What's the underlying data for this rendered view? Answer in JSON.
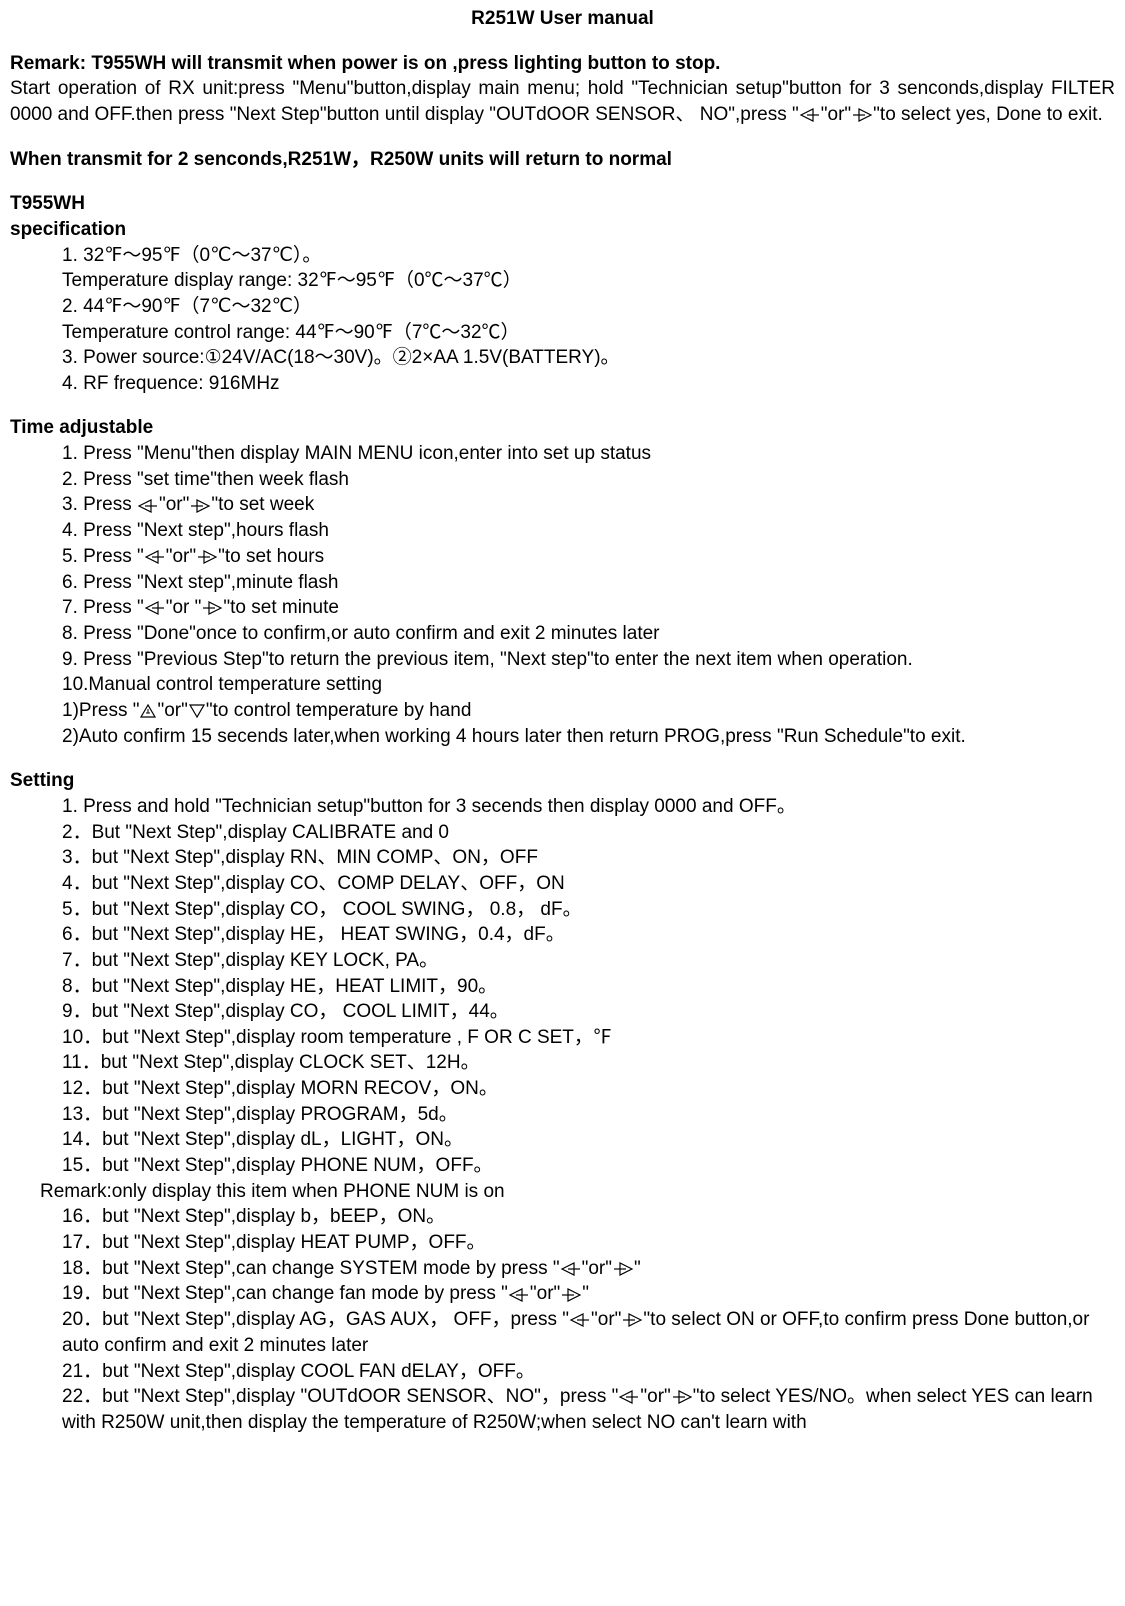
{
  "title": "R251W User manual",
  "remark": {
    "heading": "Remark: T955WH will transmit when power is on ,press lighting button to stop.",
    "line1a": "Start  operation  of  RX  unit:press  \"Menu\"button,display  main  menu;  hold  \"Technician  setup\"button  for  3 senconds,display  FILTER    0000   and  OFF.then  press  \"Next  Step\"button  until  display  \"OUTdOOR  SENSOR、",
    "line1b": "NO\",press \"",
    "line1c": "\"or\"",
    "line1d": "\"to select yes, Done to exit."
  },
  "normal_line": "When transmit for 2 senconds,R251W，R250W units  will return to normal",
  "spec_head1": "T955WH",
  "spec_head2": "specification",
  "spec": {
    "s1": "1. 32℉～95℉（0℃～37℃）。",
    "s2": "Temperature display range: 32℉～95℉（0℃～37℃）",
    "s3": "2. 44℉～90℉（7℃～32℃）",
    "s4": "Temperature control range: 44℉～90℉（7℃～32℃）",
    "s5": "3. Power source:①24V/AC(18～30V)。②2×AA 1.5V(BATTERY)。",
    "s6": "4. RF frequence: 916MHz"
  },
  "time_head": "Time adjustable",
  "time": {
    "t1": "1. Press \"Menu\"then display MAIN MENU icon,enter into set up status",
    "t2": "2. Press   \"set time\"then week flash",
    "t3a": "3. Press  ",
    "t3b": "\"or\"",
    "t3c": "\"to set week",
    "t4": "4. Press \"Next step\",hours flash",
    "t5a": "5. Press \"",
    "t5b": "\"or\"",
    "t5c": "\"to set hours",
    "t6": "6. Press \"Next step\",minute flash",
    "t7a": "7.  Press \"",
    "t7b": "\"or \"",
    "t7c": "\"to set minute",
    "t8": "8. Press \"Done\"once to confirm,or auto confirm and exit 2 minutes later",
    "t9": "9.  Press \"Previous Step\"to return the previous   item, \"Next step\"to enter the next item when operation.",
    "t10": "10.Manual control temperature setting",
    "t11a": "1)Press \"",
    "t11b": "\"or\"",
    "t11c": "\"to control temperature by hand",
    "t12": " 2)Auto confirm 15 secends later,when working 4 hours later then return PROG,press \"Run Schedule\"to exit."
  },
  "setting_head": "Setting",
  "setting_remark": "Remark:only display this item when PHONE NUM is on",
  "set": {
    "s1": "1. Press and hold \"Technician setup\"button for 3 secends then display 0000 and OFF。",
    "s2": "2．But \"Next Step\",display CALIBRATE and 0",
    "s3": "3．but \"Next Step\",display RN、MIN COMP、ON，OFF",
    "s4": "4．but \"Next Step\",display CO、COMP DELAY、OFF，ON",
    "s5": "5．but \"Next Step\",display CO，  COOL SWING，  0.8，  dF。",
    "s6": "6．but \"Next Step\",display HE，  HEAT SWING，0.4，dF。",
    "s7": "7．but \"Next Step\",display KEY LOCK, PA。",
    "s8": "8．but \"Next Step\",display HE，HEAT LIMIT，90。",
    "s9": "9．but \"Next Step\",display CO，  COOL LIMIT，44。",
    "s10": "10．but \"Next Step\",display room temperature , F OR C SET，℉",
    "s11": "11．but \"Next Step\",display CLOCK SET、12H。",
    "s12": "12．but \"Next Step\",display MORN RECOV，ON。",
    "s13": "13．but \"Next Step\",display PROGRAM，5d。",
    "s14": "14．but \"Next Step\",display dL，LIGHT，ON。",
    "s15": "15．but \"Next Step\",display PHONE NUM，OFF。",
    "s16": "16．but \"Next Step\",display b，bEEP，ON。",
    "s17": "17．but \"Next Step\",display HEAT PUMP，OFF。",
    "s18a": "18．but \"Next Step\",can change SYSTEM mode by press \"",
    "s18b": "\"or\"",
    "s18c": "\"",
    "s19a": "19．but \"Next Step\",can change fan mode by press \"",
    "s19b": "\"or\"",
    "s19c": "\"",
    "s20a": "20．but \"Next Step\",display AG，GAS AUX，  OFF，press \"",
    "s20b": "\"or\"",
    "s20c": "\"to select ON or OFF,to confirm press Done button,or auto confirm and exit 2 minutes later",
    "s21": "21．but \"Next Step\",display COOL FAN dELAY，OFF。",
    "s22a": "22．but \"Next Step\",display \"OUTdOOR SENSOR、NO\"，press \"",
    "s22b": "\"or\"",
    "s22c": "\"to select YES/NO。when select YES can learn with R250W unit,then display the temperature of R250W;when select NO can't learn with"
  }
}
